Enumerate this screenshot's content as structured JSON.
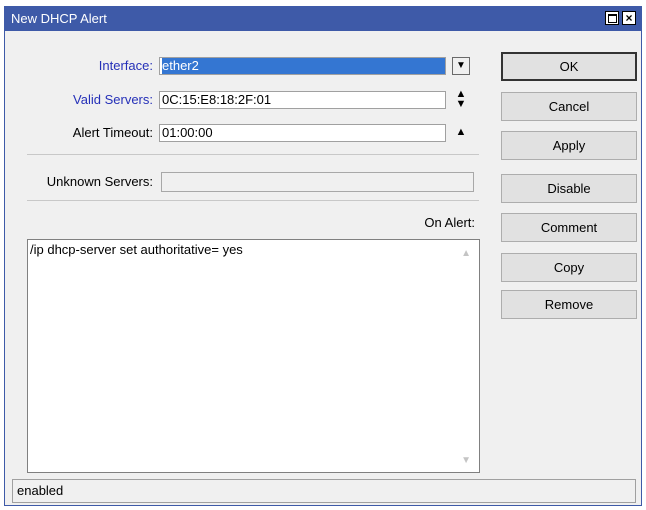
{
  "window": {
    "title": "New DHCP Alert"
  },
  "form": {
    "interface_label": "Interface:",
    "interface_value": "ether2",
    "valid_servers_label": "Valid Servers:",
    "valid_servers_value": "0C:15:E8:18:2F:01",
    "alert_timeout_label": "Alert Timeout:",
    "alert_timeout_value": "01:00:00",
    "unknown_servers_label": "Unknown Servers:",
    "unknown_servers_value": "",
    "on_alert_label": "On Alert:",
    "on_alert_script": "/ip dhcp-server set authoritative= yes"
  },
  "buttons": {
    "ok": "OK",
    "cancel": "Cancel",
    "apply": "Apply",
    "disable": "Disable",
    "comment": "Comment",
    "copy": "Copy",
    "remove": "Remove"
  },
  "status": {
    "text": "enabled"
  },
  "colors": {
    "titlebar": "#3e5aa8",
    "blue_label": "#2530b8",
    "selection": "#3476d2"
  }
}
